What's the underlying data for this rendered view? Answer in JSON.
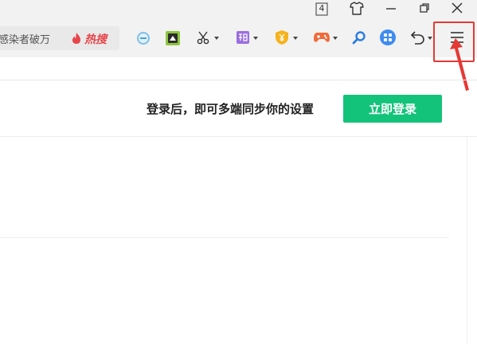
{
  "window": {
    "tab_count": "4",
    "controls": [
      "skin-icon",
      "minimize-icon",
      "restore-icon",
      "close-icon"
    ]
  },
  "search": {
    "text": "感染者破万",
    "hot_label": "热搜"
  },
  "toolbar": {
    "icons": [
      "minus-circle-icon",
      "screenshot-icon",
      "scissors-icon",
      "translate-icon",
      "shield-coin-icon",
      "gamepad-icon",
      "search-icon",
      "apps-icon",
      "undo-icon",
      "menu-icon"
    ]
  },
  "sync_banner": {
    "message": "登录后，即可多端同步你的设置",
    "login_button": "立即登录"
  },
  "colors": {
    "accent_green": "#14c37a",
    "highlight_red": "#e53935",
    "toolbar_bg": "#f2f2f2"
  }
}
